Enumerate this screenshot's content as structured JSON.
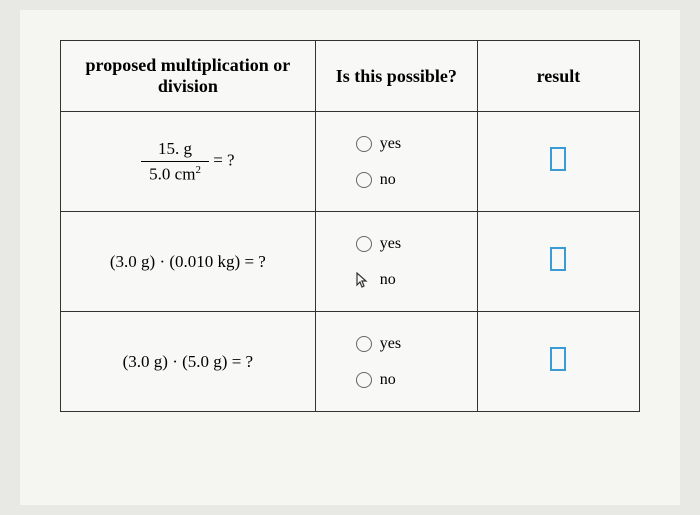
{
  "headers": {
    "proposed": "proposed multiplication or division",
    "possible": "Is this possible?",
    "result": "result"
  },
  "rows": [
    {
      "frac_num": "15. g",
      "frac_den_base": "5.0 cm",
      "frac_den_exp": "2",
      "equals": " = ?",
      "yes": "yes",
      "no": "no"
    },
    {
      "expr": "(3.0 g) · (0.010 kg) = ?",
      "yes": "yes",
      "no": "no"
    },
    {
      "expr": "(3.0 g) · (5.0 g) = ?",
      "yes": "yes",
      "no": "no"
    }
  ]
}
